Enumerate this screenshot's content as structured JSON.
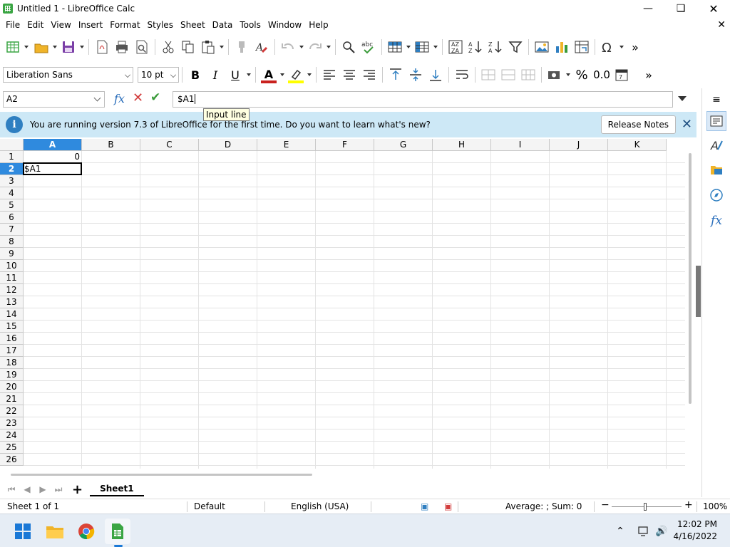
{
  "window": {
    "title": "Untitled 1 - LibreOffice Calc",
    "controls": [
      "minimize-icon",
      "maximize-icon",
      "close-icon"
    ]
  },
  "menu": [
    "File",
    "Edit",
    "View",
    "Insert",
    "Format",
    "Styles",
    "Sheet",
    "Data",
    "Tools",
    "Window",
    "Help"
  ],
  "formatting": {
    "font_name": "Liberation Sans",
    "font_size": "10 pt",
    "bold": "B",
    "italic": "I",
    "underline": "U",
    "font_color_glyph": "A",
    "percent_glyph": "%",
    "decimal_glyph": "0.0",
    "font_color": "#c9211e",
    "highlight_color": "#ffff00"
  },
  "formula_bar": {
    "name_box": "A2",
    "input_value": "$A1",
    "tooltip": "Input line"
  },
  "infobar": {
    "message": "You are running version 7.3 of LibreOffice for the first time. Do you want to learn what's new?",
    "button": "Release Notes"
  },
  "grid": {
    "columns": [
      "A",
      "B",
      "C",
      "D",
      "E",
      "F",
      "G",
      "H",
      "I",
      "J",
      "K"
    ],
    "rows": [
      "1",
      "2",
      "3",
      "4",
      "5",
      "6",
      "7",
      "8",
      "9",
      "10",
      "11",
      "12",
      "13",
      "14",
      "15",
      "16",
      "17",
      "18",
      "19",
      "20",
      "21",
      "22",
      "23",
      "24",
      "25",
      "26"
    ],
    "selected_column": "A",
    "selected_row": "2",
    "cells": {
      "A1": "0",
      "A2": "$A1"
    }
  },
  "sheet_tabs": {
    "add_glyph": "+",
    "active": "Sheet1"
  },
  "status_bar": {
    "sheet": "Sheet 1 of 1",
    "page_style": "Default",
    "language": "English (USA)",
    "summary": "Average: ; Sum: 0",
    "zoom": "100%"
  },
  "taskbar": {
    "time": "12:02 PM",
    "date": "4/16/2022"
  },
  "colors": {
    "accent": "#2f8ade",
    "infobar_bg": "#cde8f6",
    "calc_green": "#3aa543"
  }
}
